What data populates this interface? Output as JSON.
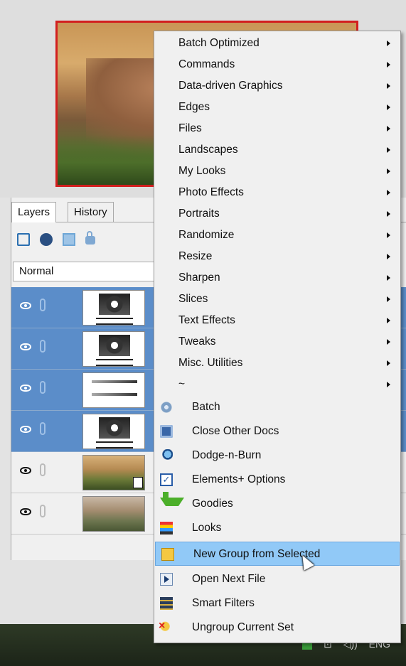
{
  "panel": {
    "tabs": [
      {
        "label": "Layers"
      },
      {
        "label": "History"
      }
    ],
    "blend_mode": "Normal",
    "layers": [
      {
        "kind": "adjustment-gear",
        "selected": true
      },
      {
        "kind": "adjustment-gear",
        "selected": true
      },
      {
        "kind": "adjustment-levels",
        "selected": true
      },
      {
        "kind": "adjustment-gear",
        "selected": true
      },
      {
        "kind": "smart-object-photo",
        "selected": false
      },
      {
        "kind": "photo",
        "selected": false
      }
    ]
  },
  "taskbar": {
    "language": "ENG"
  },
  "menu": {
    "submenus": [
      {
        "label": "Batch Optimized"
      },
      {
        "label": "Commands"
      },
      {
        "label": "Data-driven Graphics"
      },
      {
        "label": "Edges"
      },
      {
        "label": "Files"
      },
      {
        "label": "Landscapes"
      },
      {
        "label": "My Looks"
      },
      {
        "label": "Photo Effects"
      },
      {
        "label": "Portraits"
      },
      {
        "label": "Randomize"
      },
      {
        "label": "Resize"
      },
      {
        "label": "Sharpen"
      },
      {
        "label": "Slices"
      },
      {
        "label": "Text Effects"
      },
      {
        "label": "Tweaks"
      },
      {
        "label": "Misc. Utilities"
      },
      {
        "label": "~"
      }
    ],
    "actions": [
      {
        "label": "Batch",
        "icon": "batch-gear-icon"
      },
      {
        "label": "Close Other Docs",
        "icon": "close-docs-icon"
      },
      {
        "label": "Dodge-n-Burn",
        "icon": "dodge-burn-icon"
      },
      {
        "label": "Elements+ Options",
        "icon": "checkbox-icon"
      },
      {
        "label": "Goodies",
        "icon": "download-arrow-icon"
      },
      {
        "label": "Looks",
        "icon": "color-stripes-icon"
      },
      {
        "label": "New Group from Selected",
        "icon": "folder-group-icon",
        "highlighted": true
      },
      {
        "label": "Open Next File",
        "icon": "play-next-icon"
      },
      {
        "label": "Smart Filters",
        "icon": "smart-filters-icon"
      },
      {
        "label": "Ungroup Current Set",
        "icon": "ungroup-icon"
      }
    ]
  }
}
